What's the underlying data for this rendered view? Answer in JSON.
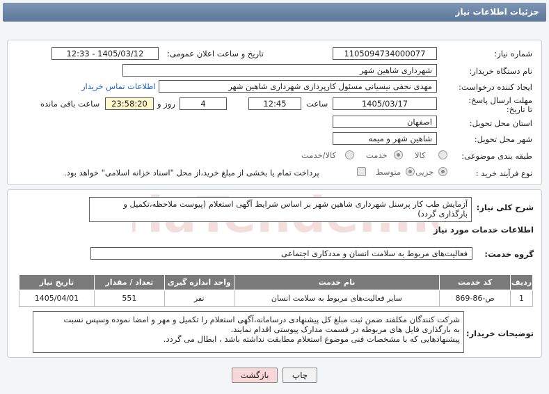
{
  "title": "جزئیات اطلاعات نیاز",
  "fields": {
    "need_number_label": "شماره نیاز:",
    "need_number": "1105094734000077",
    "announce_label": "تاریخ و ساعت اعلان عمومی:",
    "announce_value": "1405/03/12 - 12:33",
    "buyer_org_label": "نام دستگاه خریدار:",
    "buyer_org": "شهرداری شاهین شهر",
    "creator_label": "ایجاد کننده درخواست:",
    "creator": "مهدی نجفی نیسیانی مسئول کارپردازی شهرداری شاهین شهر",
    "contact_link": "اطلاعات تماس خریدار",
    "deadline_label": "مهلت ارسال پاسخ: تا تاریخ:",
    "deadline_date": "1405/03/17",
    "time_label": "ساعت",
    "deadline_time": "12:45",
    "days_value": "4",
    "days_label": "روز و",
    "remaining_time": "23:58:20",
    "remaining_label": "ساعت باقی مانده",
    "province_label": "استان محل تحویل:",
    "province": "اصفهان",
    "city_label": "شهر محل تحویل:",
    "city": "شاهین شهر و میمه",
    "category_label": "طبقه بندی موضوعی:",
    "category_options": [
      "کالا",
      "خدمت",
      "کالا/خدمت"
    ],
    "category_selected": "خدمت",
    "process_label": "نوع فرآیند خرید :",
    "process_options": [
      "جزیی",
      "متوسط"
    ],
    "process_selected": "جزیی",
    "payment_note": "پرداخت تمام یا بخشی از مبلغ خرید،از محل \"اسناد خزانه اسلامی\" خواهد بود."
  },
  "summary": {
    "label": "شرح کلی نیاز:",
    "text": "آزمایش طب کار پرسنل شهرداری شاهین شهر بر اساس شرایط آگهی استعلام (پیوست ملاحظه،تکمیل و بارگذاری گردد)"
  },
  "services": {
    "heading": "اطلاعات خدمات مورد نیاز",
    "group_label": "گروه خدمت:",
    "group_value": "فعالیت‌های مربوط به سلامت انسان و مددکاری اجتماعی",
    "columns": [
      "ردیف",
      "کد خدمت",
      "نام خدمت",
      "واحد اندازه گیری",
      "تعداد / مقدار",
      "تاریخ نیاز"
    ],
    "rows": [
      [
        "1",
        "ص-86-869",
        "سایر فعالیت‌های مربوط به سلامت انسان",
        "نفر",
        "551",
        "1405/04/01"
      ]
    ]
  },
  "notes": {
    "label": "توضیحات خریدار:",
    "lines": [
      "شرکت کنندگان مکلفند ضمن ثبت مبلغ کل پیشنهادی درسامانه،آگهی استعلام را  تکمیل و مهر و امضا نموده وسپس نسبت",
      "به بارگذاری فایل های مربوطه در قسمت مدارک پیوستی اقدام نمایند.",
      "پیشنهادهایی که با مشخصات فنی موضوع استعلام مطابقت نداشته باشد ، ابطال می گردد."
    ]
  },
  "buttons": {
    "print": "چاپ",
    "back": "بازگشت"
  },
  "watermark": "AriaTender.net",
  "colors": {
    "header": "#5d789c",
    "link": "#1a5fc7",
    "highlight": "#fff8cc",
    "back_button": "#f7d7d7"
  }
}
